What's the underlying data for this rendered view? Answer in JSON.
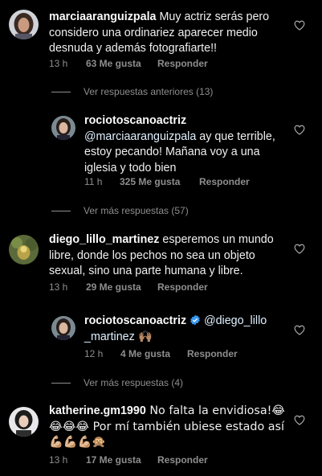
{
  "comments": [
    {
      "username": "marciaaranguizpala",
      "text": " Muy actriz serás pero considero una ordinariez aparecer medio desnuda y además fotografiarte!!",
      "time": "13 h",
      "likes": "63 Me gusta",
      "reply": "Responder"
    },
    {
      "username": "rociotoscanoactriz",
      "mention": "@marciaaranguizpala",
      "text": " ay que terrible, estoy pecando! Mañana voy a una iglesia y todo bien",
      "time": "11 h",
      "likes": "325 Me gusta",
      "reply": "Responder"
    },
    {
      "username": "diego_lillo_martinez",
      "text": " esperemos un mundo libre, donde los pechos no sea un objeto sexual, sino una parte humana y libre.",
      "time": "13 h",
      "likes": "29 Me gusta",
      "reply": "Responder"
    },
    {
      "username": "rociotoscanoactriz",
      "mention": "@diego_lillo_martinez",
      "text": " 🙌🏽",
      "time": "12 h",
      "likes": "4 Me gusta",
      "reply": "Responder"
    },
    {
      "username": "katherine.gm1990",
      "text": " No falta la envidiosa!😂😂😂😂 Por mí también ubiese estado así 💪🏼💪🏼💪🏼🙊",
      "time": "13 h",
      "likes": "17 Me gusta",
      "reply": "Responder"
    }
  ],
  "view_previous": "Ver respuestas anteriores (13)",
  "view_more_1": "Ver más respuestas (57)",
  "view_more_2": "Ver más respuestas (4)",
  "icons": {
    "like": "heart-outline-icon",
    "verified": "verified-badge-icon"
  },
  "colors": {
    "background": "#000000",
    "text": "#f5f5f5",
    "meta": "#8e8e8e",
    "verified": "#3897f0"
  }
}
